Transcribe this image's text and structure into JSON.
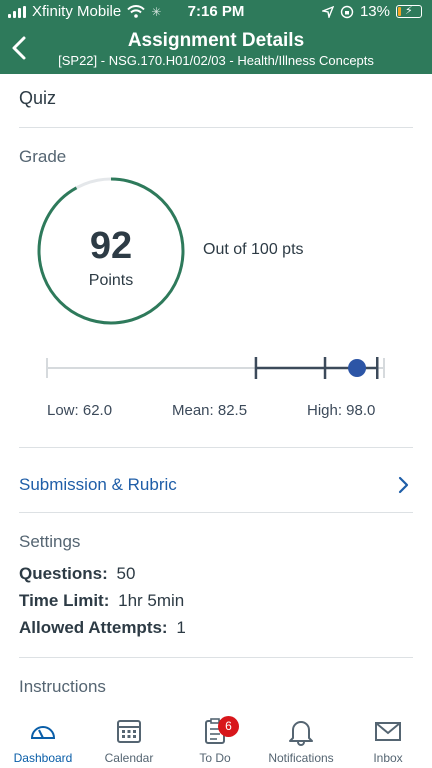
{
  "status_bar": {
    "carrier": "Xfinity Mobile",
    "time": "7:16 PM",
    "battery": "13%",
    "battery_level": 0.13
  },
  "header": {
    "title": "Assignment Details",
    "subtitle": "[SP22] - NSG.170.H01/02/03 - Health/Illness Concepts",
    "back_icon": "chevron-left-icon"
  },
  "assignment": {
    "type_value": "Quiz"
  },
  "grade": {
    "heading": "Grade",
    "score": "92",
    "unit": "Points",
    "out_of": "Out of 100 pts",
    "score_fraction": 0.92,
    "stats": {
      "low_label": "Low: 62.0",
      "mean_label": "Mean: 82.5",
      "high_label": "High: 98.0",
      "low": 62.0,
      "mean": 82.5,
      "high": 98.0,
      "score": 92
    }
  },
  "submission": {
    "label": "Submission & Rubric"
  },
  "settings": {
    "heading": "Settings",
    "questions_label": "Questions:",
    "questions_value": "50",
    "time_limit_label": "Time Limit:",
    "time_limit_value": "1hr 5min",
    "attempts_label": "Allowed Attempts:",
    "attempts_value": "1"
  },
  "instructions": {
    "heading": "Instructions"
  },
  "tabbar": {
    "dashboard": "Dashboard",
    "calendar": "Calendar",
    "todo": "To Do",
    "todo_badge": "6",
    "notifications": "Notifications",
    "inbox": "Inbox"
  },
  "colors": {
    "header_bg": "#2e7a5b",
    "ring": "#2e7a5b",
    "link": "#1f5ea8",
    "score_dot": "#2c55a6",
    "badge": "#d8161b"
  }
}
